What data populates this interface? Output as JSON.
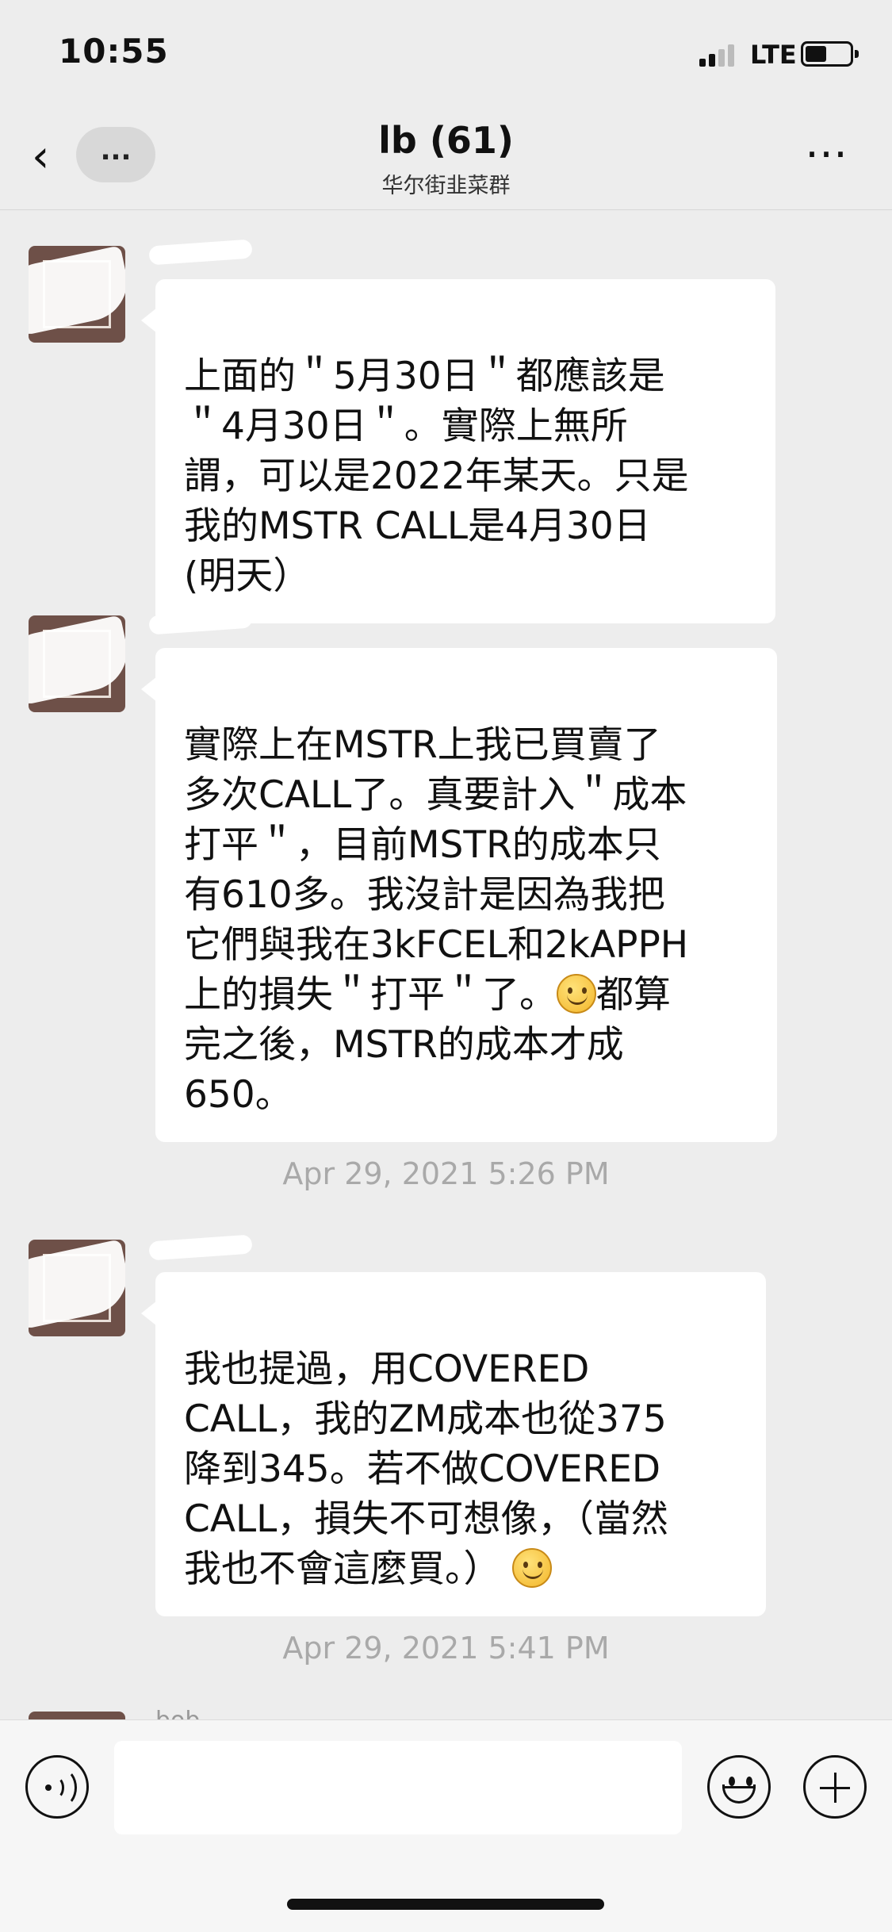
{
  "status_bar": {
    "time": "10:55",
    "network": "LTE"
  },
  "header": {
    "title": "lb (61)",
    "subtitle": "华尔街韭菜群",
    "unread_label": "..."
  },
  "messages": [
    {
      "text": "上面的＂5月30日＂都應該是\n＂4月30日＂。實際上無所\n謂，可以是2022年某天。只是\n我的MSTR CALL是4月30日\n(明天）"
    },
    {
      "text_before_emoji": "實際上在MSTR上我已買賣了\n多次CALL了。真要計入＂成本\n打平＂，目前MSTR的成本只\n有610多。我沒計是因為我把\n它們與我在3kFCEL和2kAPPH\n上的損失＂打平＂了。",
      "text_after_emoji": "都算\n完之後，MSTR的成本才成\n650。"
    },
    {
      "text_before_emoji": "我也提過，用COVERED\nCALL，我的ZM成本也從375\n降到345。若不做COVERED\nCALL，損失不可想像，（當然\n我也不會這麼買。）",
      "text_after_emoji": ""
    }
  ],
  "timestamps": [
    "Apr 29, 2021 5:26 PM",
    "Apr 29, 2021 5:41 PM"
  ],
  "partial_sender": "bob",
  "input": {
    "placeholder": ""
  },
  "colors": {
    "background": "#ededed",
    "bubble": "#ffffff",
    "timestamp": "#a9a9a9",
    "avatar": "#6e5048"
  }
}
